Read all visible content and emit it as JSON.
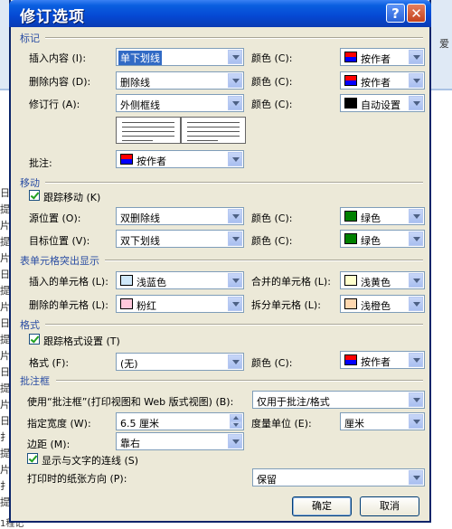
{
  "dialog": {
    "title": "修订选项",
    "help_glyph": "?",
    "close_glyph": "✕"
  },
  "colors": {
    "red_blue_swatch_top": "#ff0000",
    "red_blue_swatch_bottom": "#0000ff",
    "black": "#000000",
    "green": "#008000",
    "light_blue": "#cfe8f9",
    "pink": "#ffc8dc",
    "light_yellow": "#ffffcc",
    "light_orange": "#ffd8b0",
    "title_blue": "#0548d3",
    "section_blue": "#2a4da3"
  },
  "markup": {
    "title": "标记",
    "insert_label": "插入内容 (I):",
    "insert_value": "单下划线",
    "insert_color_label": "颜色 (C):",
    "insert_color_value": "按作者",
    "delete_label": "删除内容 (D):",
    "delete_value": "删除线",
    "delete_color_label": "颜色 (C):",
    "delete_color_value": "按作者",
    "changed_lines_label": "修订行 (A):",
    "changed_lines_value": "外侧框线",
    "changed_lines_color_label": "颜色 (C):",
    "changed_lines_color_value": "自动设置",
    "comments_label": "批注:",
    "comments_value": "按作者"
  },
  "moves": {
    "title": "移动",
    "track_label": "跟踪移动 (K)",
    "from_label": "源位置 (O):",
    "from_value": "双删除线",
    "from_color_label": "颜色 (C):",
    "from_color_value": "绿色",
    "to_label": "目标位置 (V):",
    "to_value": "双下划线",
    "to_color_label": "颜色 (C):",
    "to_color_value": "绿色"
  },
  "table_highlight": {
    "title": "表单元格突出显示",
    "inserted_label": "插入的单元格 (L):",
    "inserted_value": "浅蓝色",
    "merged_label": "合并的单元格 (L):",
    "merged_value": "浅黄色",
    "deleted_label": "删除的单元格 (L):",
    "deleted_value": "粉红",
    "split_label": "拆分单元格 (L):",
    "split_value": "浅橙色"
  },
  "formatting": {
    "title": "格式",
    "track_label": "跟踪格式设置 (T)",
    "format_label": "格式 (F):",
    "format_value": "(无)",
    "color_label": "颜色 (C):",
    "color_value": "按作者"
  },
  "balloons": {
    "title": "批注框",
    "use_label": "使用“批注框”(打印视图和 Web 版式视图) (B):",
    "use_value": "仅用于批注/格式",
    "width_label": "指定宽度 (W):",
    "width_value": "6.5 厘米",
    "unit_label": "度量单位 (E):",
    "unit_value": "厘米",
    "margin_label": "边距 (M):",
    "margin_value": "靠右",
    "show_lines_label": "显示与文字的连线 (S)",
    "paper_label": "打印时的纸张方向 (P):",
    "paper_value": "保留"
  },
  "buttons": {
    "ok": "确定",
    "cancel": "取消"
  },
  "background": {
    "left_chars": [
      "日",
      "提",
      "片",
      "提",
      "片",
      "日",
      "提",
      "片",
      "日",
      "提",
      "片",
      "日",
      "提",
      "片",
      "日",
      "扌",
      "提",
      "片",
      "扌",
      "提"
    ],
    "right_char": "爱",
    "bottom_text": "1程记"
  }
}
